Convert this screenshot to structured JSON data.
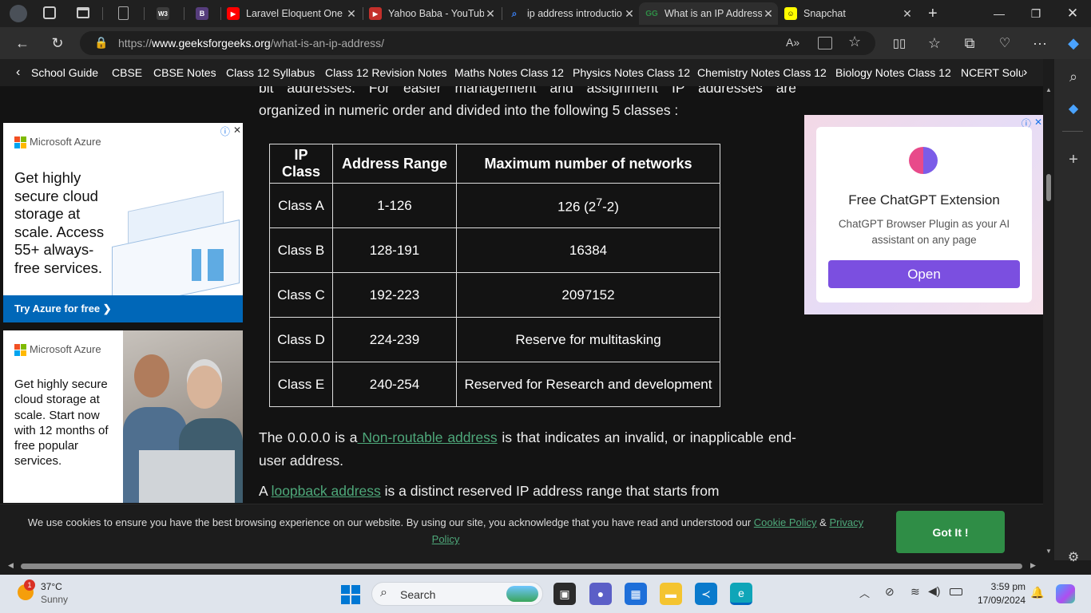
{
  "browser": {
    "tabs": [
      {
        "title": "",
        "icon": "w3schools-icon",
        "color": "#3c3c3c"
      },
      {
        "title": "",
        "icon": "bootstrap-icon",
        "color": "#563d7c"
      },
      {
        "title": "Laravel Eloquent One",
        "icon": "youtube-icon",
        "color": "#ff0000"
      },
      {
        "title": "Yahoo Baba - YouTub",
        "icon": "youtube-icon",
        "color": "#c4302b"
      },
      {
        "title": "ip address introductio",
        "icon": "search-icon",
        "color": "#3b82f6"
      },
      {
        "title": "What is an IP Address",
        "icon": "gfg-icon",
        "color": "#2f8d46",
        "active": true
      },
      {
        "title": "Snapchat",
        "icon": "snapchat-icon",
        "color": "#fffc00"
      }
    ],
    "url_prefix": "https://",
    "url_domain": "www.geeksforgeeks.org",
    "url_path": "/what-is-an-ip-address/"
  },
  "bookmarks": [
    "School Guide",
    "CBSE",
    "CBSE Notes",
    "Class 12 Syllabus",
    "Class 12 Revision Notes",
    "Maths Notes Class 12",
    "Physics Notes Class 12",
    "Chemistry Notes Class 12",
    "Biology Notes Class 12",
    "NCERT Soluti"
  ],
  "article": {
    "intro_line1": "bit addresses. For easier management and assignment IP addresses are",
    "intro_line2": "organized in numeric order and divided into the following 5 classes :",
    "table": {
      "headers": [
        "IP Class",
        "Address Range",
        "Maximum number of networks"
      ],
      "rows": [
        {
          "cls": "Class A",
          "range": "1-126",
          "networks": "126 (2",
          "sup": "7",
          "tail": "-2)"
        },
        {
          "cls": "Class B",
          "range": "128-191",
          "networks": "16384"
        },
        {
          "cls": "Class C",
          "range": "192-223",
          "networks": "2097152"
        },
        {
          "cls": "Class D",
          "range": "224-239",
          "networks": "Reserve for multitasking"
        },
        {
          "cls": "Class E",
          "range": "240-254",
          "networks": "Reserved for Research and development"
        }
      ]
    },
    "p2_a": "The 0.0.0.0 is a",
    "p2_link": " Non-routable address",
    "p2_b": " is  that indicates an invalid, or inapplicable end-user address.",
    "p3_a": "A ",
    "p3_link": "loopback address",
    "p3_b": " is a distinct reserved IP address range that starts from"
  },
  "ads": {
    "left1": {
      "brand": "Microsoft Azure",
      "headline": "Get highly secure cloud storage at scale. Access 55+ always-free services.",
      "cta": "Try Azure for free ❯"
    },
    "left2": {
      "brand": "Microsoft Azure",
      "headline": "Get highly secure cloud storage at scale. Start now with 12 months of free popular services."
    },
    "right": {
      "title": "Free ChatGPT Extension",
      "desc": "ChatGPT Browser Plugin as your AI assistant on any page",
      "cta": "Open"
    }
  },
  "cookie": {
    "text": "We use cookies to ensure you have the best browsing experience on our website. By using our site, you acknowledge that you have read and understood our ",
    "link1": "Cookie Policy",
    "amp": " & ",
    "link2": "Privacy Policy",
    "button": "Got It !"
  },
  "taskbar": {
    "weather_temp": "37°C",
    "weather_desc": "Sunny",
    "weather_badge": "1",
    "search": "Search",
    "time": "3:59 pm",
    "date": "17/09/2024"
  }
}
